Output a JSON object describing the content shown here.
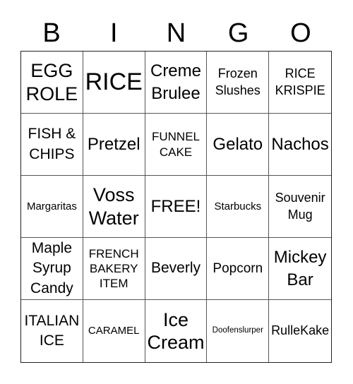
{
  "header": {
    "letters": [
      "B",
      "I",
      "N",
      "G",
      "O"
    ]
  },
  "board": {
    "cells": [
      [
        "EGG ROLE",
        "RICE",
        "Creme Brulee",
        "Frozen Slushes",
        "RICE KRISPIE"
      ],
      [
        "FISH & CHIPS",
        "Pretzel",
        "FUNNEL CAKE",
        "Gelato",
        "Nachos"
      ],
      [
        "Margaritas",
        "Voss Water",
        "FREE!",
        "Starbucks",
        "Souvenir Mug"
      ],
      [
        "Maple Syrup Candy",
        "FRENCH BAKERY ITEM",
        "Beverly",
        "Popcorn",
        "Mickey Bar"
      ],
      [
        "ITALIAN ICE",
        "CARAMEL",
        "Ice Cream",
        "Doofenslurper",
        "RulleKake"
      ]
    ]
  },
  "colors": {
    "background": "#ffffff",
    "text": "#000000",
    "grid_line": "#555555"
  }
}
